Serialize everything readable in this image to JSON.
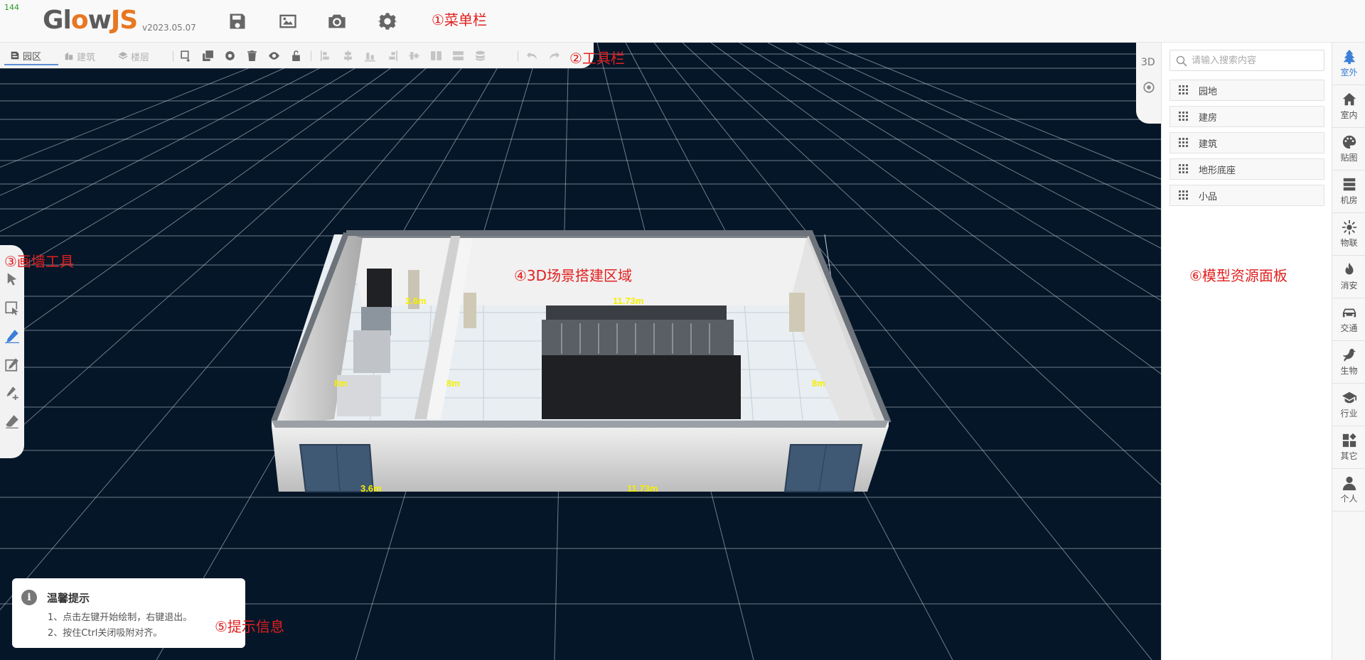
{
  "fps": "144",
  "logo": {
    "text_a": "Gl",
    "text_o": "o",
    "text_w": "w",
    "text_js": "JS",
    "version": "v2023.05.07"
  },
  "menubar": {
    "icons": [
      "save-icon",
      "image-icon",
      "camera-icon",
      "settings-icon"
    ]
  },
  "annotations": {
    "menubar": "①菜单栏",
    "toolbar": "②工具栏",
    "walltools": "③画墙工具",
    "scene": "④3D场景搭建区域",
    "tips": "⑤提示信息",
    "resources": "⑥模型资源面板"
  },
  "toolbar": {
    "tabs": [
      {
        "label": "园区",
        "active": true
      },
      {
        "label": "建筑",
        "active": false
      },
      {
        "label": "楼层",
        "active": false
      }
    ]
  },
  "scene": {
    "dimensions": {
      "top_left": "3.6m",
      "top_right": "11.73m",
      "left_a": "8m",
      "left_b": "8m",
      "right": "8m",
      "bottom_left": "3.6m",
      "bottom_right": "11.73m"
    },
    "background": "#051628"
  },
  "view": {
    "mode_label": "3D"
  },
  "tip": {
    "title": "温馨提示",
    "lines": [
      "1、点击左键开始绘制，右键退出。",
      "2、按住Ctrl关闭吸附对齐。"
    ]
  },
  "resources": {
    "search_placeholder": "请输入搜索内容",
    "search_value": "",
    "categories": [
      "园地",
      "建房",
      "建筑",
      "地形底座",
      "小品"
    ]
  },
  "sidenav": [
    {
      "label": "室外",
      "icon": "tree-icon",
      "active": true
    },
    {
      "label": "室内",
      "icon": "home-icon",
      "active": false
    },
    {
      "label": "贴图",
      "icon": "palette-icon",
      "active": false
    },
    {
      "label": "机房",
      "icon": "server-icon",
      "active": false
    },
    {
      "label": "物联",
      "icon": "iot-icon",
      "active": false
    },
    {
      "label": "消安",
      "icon": "fire-icon",
      "active": false
    },
    {
      "label": "交通",
      "icon": "car-icon",
      "active": false
    },
    {
      "label": "生物",
      "icon": "bird-icon",
      "active": false
    },
    {
      "label": "行业",
      "icon": "graduation-icon",
      "active": false
    },
    {
      "label": "其它",
      "icon": "apps-icon",
      "active": false
    },
    {
      "label": "个人",
      "icon": "user-icon",
      "active": false
    }
  ],
  "colors": {
    "accent": "#3a7fd5",
    "annotation": "#e21f1f",
    "dimension": "#f4f000",
    "logo_orange": "#e87722"
  }
}
